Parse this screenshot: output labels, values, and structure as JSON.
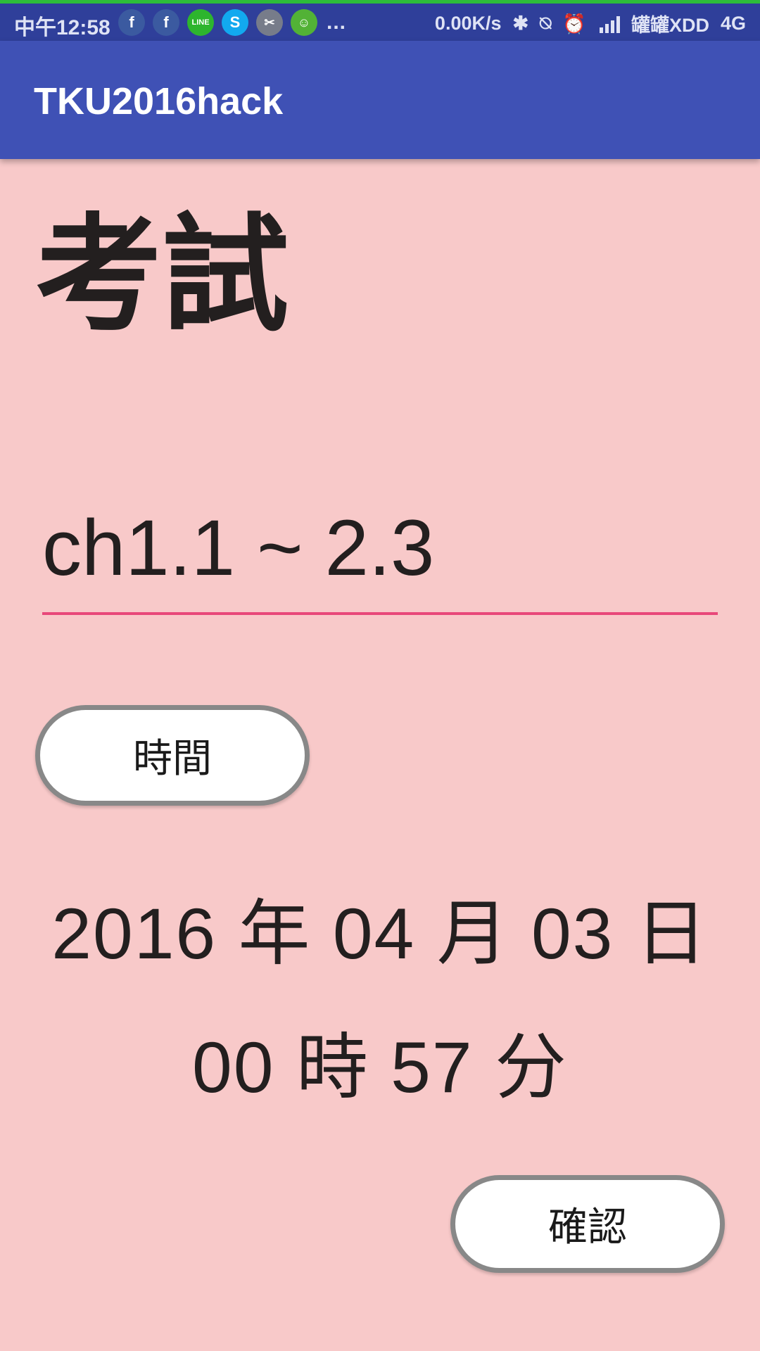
{
  "status_bar": {
    "time": "中午12:58",
    "notification_icons": [
      "facebook-icon",
      "facebook-icon",
      "line-icon",
      "skype-icon",
      "app-icon",
      "frog-icon"
    ],
    "more": "...",
    "net_speed": "0.00K/s",
    "carrier": "罐罐XDD",
    "network": "4G"
  },
  "app_bar": {
    "title": "TKU2016hack"
  },
  "main": {
    "heading": "考試",
    "range_value": "ch1.1 ~ 2.3",
    "time_button_label": "時間",
    "date_text": "2016 年 04 月 03 日",
    "time_text": "00 時 57 分",
    "confirm_button_label": "確認"
  },
  "colors": {
    "background": "#f8c9c9",
    "app_bar": "#3f51b5",
    "status_bar": "#2f3f9a",
    "input_underline": "#e8487a"
  }
}
